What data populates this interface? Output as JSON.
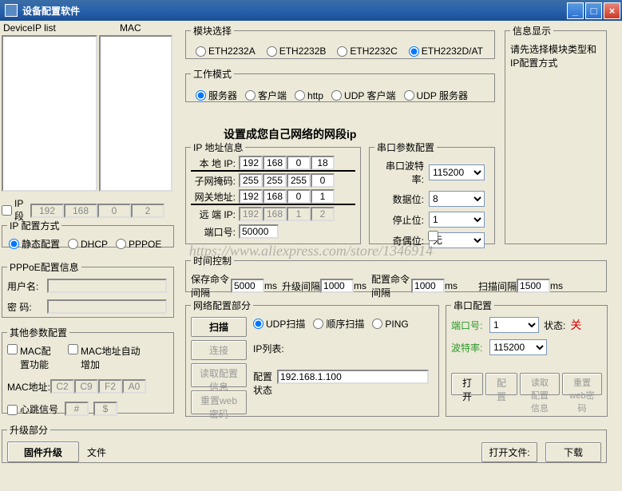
{
  "title": "设备配置软件",
  "headers": {
    "deviceip": "DeviceIP list",
    "mac": "MAC"
  },
  "ipseg": {
    "label": "IP 段",
    "a": "192",
    "b": "168",
    "c": "0",
    "d": "2"
  },
  "ipcfg": {
    "legend": "IP 配置方式",
    "static": "静态配置",
    "dhcp": "DHCP",
    "pppoe": "PPPOE"
  },
  "pppoe": {
    "legend": "PPPoE配置信息",
    "user": "用户名:",
    "pass": "密 码:"
  },
  "other": {
    "legend": "其他参数配置",
    "macfn": "MAC配置功能",
    "macauto": "MAC地址自动增加",
    "macaddr": "MAC地址:",
    "m1": "C2",
    "m2": "C9",
    "m3": "F2",
    "m4": "A0",
    "heartbeat": "心跳信号",
    "hb1": "#",
    "hb2": "$"
  },
  "module": {
    "legend": "模块选择",
    "o1": "ETH2232A",
    "o2": "ETH2232B",
    "o3": "ETH2232C",
    "o4": "ETH2232D/AT"
  },
  "mode": {
    "legend": "工作模式",
    "o1": "服务器",
    "o2": "客户端",
    "o3": "http",
    "o4": "UDP 客户端",
    "o5": "UDP 服务器"
  },
  "banner": "设置成您自己网络的网段ip",
  "ipaddr": {
    "legend": "IP 地址信息",
    "local": "本 地 IP:",
    "l": [
      "192",
      "168",
      "0",
      "18"
    ],
    "mask": "子网掩码:",
    "m": [
      "255",
      "255",
      "255",
      "0"
    ],
    "gate": "网关地址:",
    "g": [
      "192",
      "168",
      "0",
      "1"
    ],
    "remote": "远 端 IP:",
    "r": [
      "192",
      "168",
      "1",
      "2"
    ],
    "port": "端口号:",
    "portval": "50000"
  },
  "serial": {
    "legend": "串口参数配置",
    "baud": "串口波特率:",
    "baudval": "115200",
    "data": "数据位:",
    "dataval": "8",
    "stop": "停止位:",
    "stopval": "1",
    "parity": "奇偶位:",
    "parityval": "无"
  },
  "info": {
    "legend": "信息显示",
    "msg": "请先选择模块类型和IP配置方式"
  },
  "time": {
    "legend": "时间控制",
    "save": "保存命令间隔",
    "saveval": "5000",
    "up": "升级间隔",
    "upval": "1000",
    "cfg": "配置命令间隔",
    "cfgval": "1000",
    "scan": "扫描间隔",
    "scanval": "1500",
    "ms": "ms"
  },
  "net": {
    "legend": "网络配置部分",
    "scan": "扫描",
    "connect": "连接",
    "readcfg": "读取配置信息",
    "resetweb": "重置web密码",
    "udp": "UDP扫描",
    "seq": "顺序扫描",
    "ping": "PING",
    "iplist": "IP列表:",
    "cfgstatus": "配置状态",
    "ipval": "192.168.1.100"
  },
  "serialcfg": {
    "legend": "串口配置",
    "port": "端口号:",
    "portval": "1",
    "status": "状态:",
    "statusval": "关",
    "baud": "波特率:",
    "baudval": "115200",
    "open": "打开",
    "cfg": "配置",
    "read": "读取配置信息",
    "reset": "重置web密码"
  },
  "upgrade": {
    "legend": "升级部分",
    "fw": "固件升级",
    "file": "文件",
    "openfile": "打开文件:",
    "download": "下载"
  },
  "watermark": "https://www.aliexpress.com/store/1346914"
}
